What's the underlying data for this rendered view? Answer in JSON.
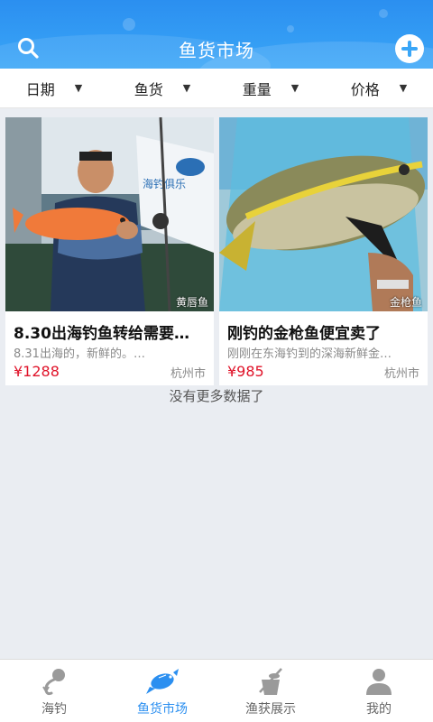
{
  "header": {
    "title": "鱼货市场",
    "accent": "#3aa6f7"
  },
  "filters": [
    {
      "label": "日期"
    },
    {
      "label": "鱼货"
    },
    {
      "label": "重量"
    },
    {
      "label": "价格"
    }
  ],
  "listings": [
    {
      "tag": "黄唇鱼",
      "title": "8.30出海钓鱼转给需要…",
      "desc": "8.31出海的，新鲜的。…",
      "price": "¥1288",
      "city": "杭州市",
      "banner_text": "海钓俱乐"
    },
    {
      "tag": "金枪鱼",
      "title": "刚钓的金枪鱼便宜卖了",
      "desc": "刚刚在东海钓到的深海新鲜金…",
      "price": "¥985",
      "city": "杭州市"
    }
  ],
  "no_more": "没有更多数据了",
  "nav": [
    {
      "label": "海钓",
      "icon": "fishing-hook-icon"
    },
    {
      "label": "鱼货市场",
      "icon": "fish-icon",
      "active": true
    },
    {
      "label": "渔获展示",
      "icon": "catch-bucket-icon"
    },
    {
      "label": "我的",
      "icon": "user-icon"
    }
  ],
  "colors": {
    "price": "#e0142a",
    "nav_active": "#2b8ff0",
    "nav_inactive": "#999999"
  }
}
